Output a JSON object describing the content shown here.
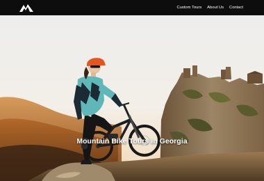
{
  "nav": {
    "links": [
      {
        "label": "Custom Tours"
      },
      {
        "label": "About Us"
      },
      {
        "label": "Contact"
      }
    ]
  },
  "hero": {
    "title": "Mountain Bike Tours in Georgia"
  },
  "colors": {
    "navbar_bg": "#0d0d0d",
    "sky_top": "#ececec",
    "jersey_teal": "#5fb7b8",
    "helmet_orange": "#e2571e",
    "hills_orange": "#c67a33"
  }
}
